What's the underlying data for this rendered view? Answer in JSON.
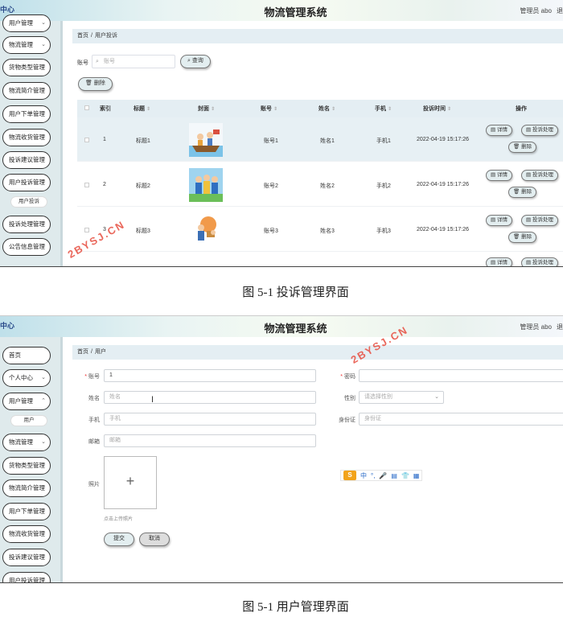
{
  "screen1": {
    "logo": "中心",
    "title": "物流管理系统",
    "admin": "管理员 abo",
    "admin_extra": "退",
    "sidebar": {
      "items": [
        {
          "label": "用户管理",
          "chevron": true
        },
        {
          "label": "物流管理",
          "chevron": true
        },
        {
          "label": "货物类型管理",
          "chevron": false
        },
        {
          "label": "物流简介管理",
          "chevron": false
        },
        {
          "label": "用户下单管理",
          "chevron": false
        },
        {
          "label": "物流收货管理",
          "chevron": false
        },
        {
          "label": "投诉建议管理",
          "chevron": false
        },
        {
          "label": "用户投诉管理",
          "chevron": true
        },
        {
          "label": "投诉处理管理",
          "chevron": false
        },
        {
          "label": "公告信息管理",
          "chevron": false
        }
      ],
      "sub_item": "用户投诉"
    },
    "breadcrumb": {
      "home": "首页",
      "sep": "/",
      "current": "用户投诉"
    },
    "search": {
      "label": "账号",
      "placeholder": "账号",
      "button": "查询"
    },
    "delete_button": "删除",
    "columns": [
      "索引",
      "标题",
      "封面",
      "账号",
      "姓名",
      "手机",
      "投诉时间",
      "操作"
    ],
    "rows": [
      {
        "index": "1",
        "title": "标题1",
        "account": "账号1",
        "name": "姓名1",
        "phone": "手机1",
        "time": "2022-04-19 15:17:26",
        "thumb": "boat-cartoon-icon"
      },
      {
        "index": "2",
        "title": "标题2",
        "account": "账号2",
        "name": "姓名2",
        "phone": "手机2",
        "time": "2022-04-19 15:17:26",
        "thumb": "workers-cartoon-icon"
      },
      {
        "index": "3",
        "title": "标题3",
        "account": "账号3",
        "name": "姓名3",
        "phone": "手机3",
        "time": "2022-04-19 15:17:26",
        "thumb": "delivery-cartoon-icon"
      }
    ],
    "actions": {
      "detail": "详情",
      "handle": "投诉处理",
      "delete": "删除"
    },
    "caption": "图 5-1  投诉管理界面",
    "watermark": "2BYSJ.CN"
  },
  "screen2": {
    "logo": "中心",
    "title": "物流管理系统",
    "admin": "管理员 abo",
    "admin_extra": "退",
    "sidebar": {
      "items": [
        {
          "label": "首页",
          "chevron": false
        },
        {
          "label": "个人中心",
          "chevron": true
        },
        {
          "label": "用户管理",
          "chevron": true
        },
        {
          "label": "物流管理",
          "chevron": true
        },
        {
          "label": "货物类型管理",
          "chevron": false
        },
        {
          "label": "物流简介管理",
          "chevron": false
        },
        {
          "label": "用户下单管理",
          "chevron": false
        },
        {
          "label": "物流收货管理",
          "chevron": false
        },
        {
          "label": "投诉建议管理",
          "chevron": false
        },
        {
          "label": "用户投诉管理",
          "chevron": false
        }
      ],
      "sub_item": "用户"
    },
    "breadcrumb": {
      "home": "首页",
      "sep": "/",
      "current": "用户"
    },
    "form": {
      "account_label": "账号",
      "account_value": "1",
      "password_label": "密码",
      "name_label": "姓名",
      "name_placeholder": "姓名",
      "gender_label": "性别",
      "gender_placeholder": "请选择性别",
      "phone_label": "手机",
      "phone_placeholder": "手机",
      "idcard_label": "身份证",
      "idcard_placeholder": "身份证",
      "email_label": "邮箱",
      "email_placeholder": "邮箱",
      "photo_label": "照片",
      "upload_hint": "点击上传照片",
      "submit": "提交",
      "cancel": "取消"
    },
    "ime": {
      "brand": "S",
      "items": [
        "中",
        "°,",
        "🎤",
        "▤",
        "👕",
        "▦"
      ]
    },
    "caption": "图 5-1  用户管理界面",
    "watermark": "2BYSJ.CN"
  }
}
